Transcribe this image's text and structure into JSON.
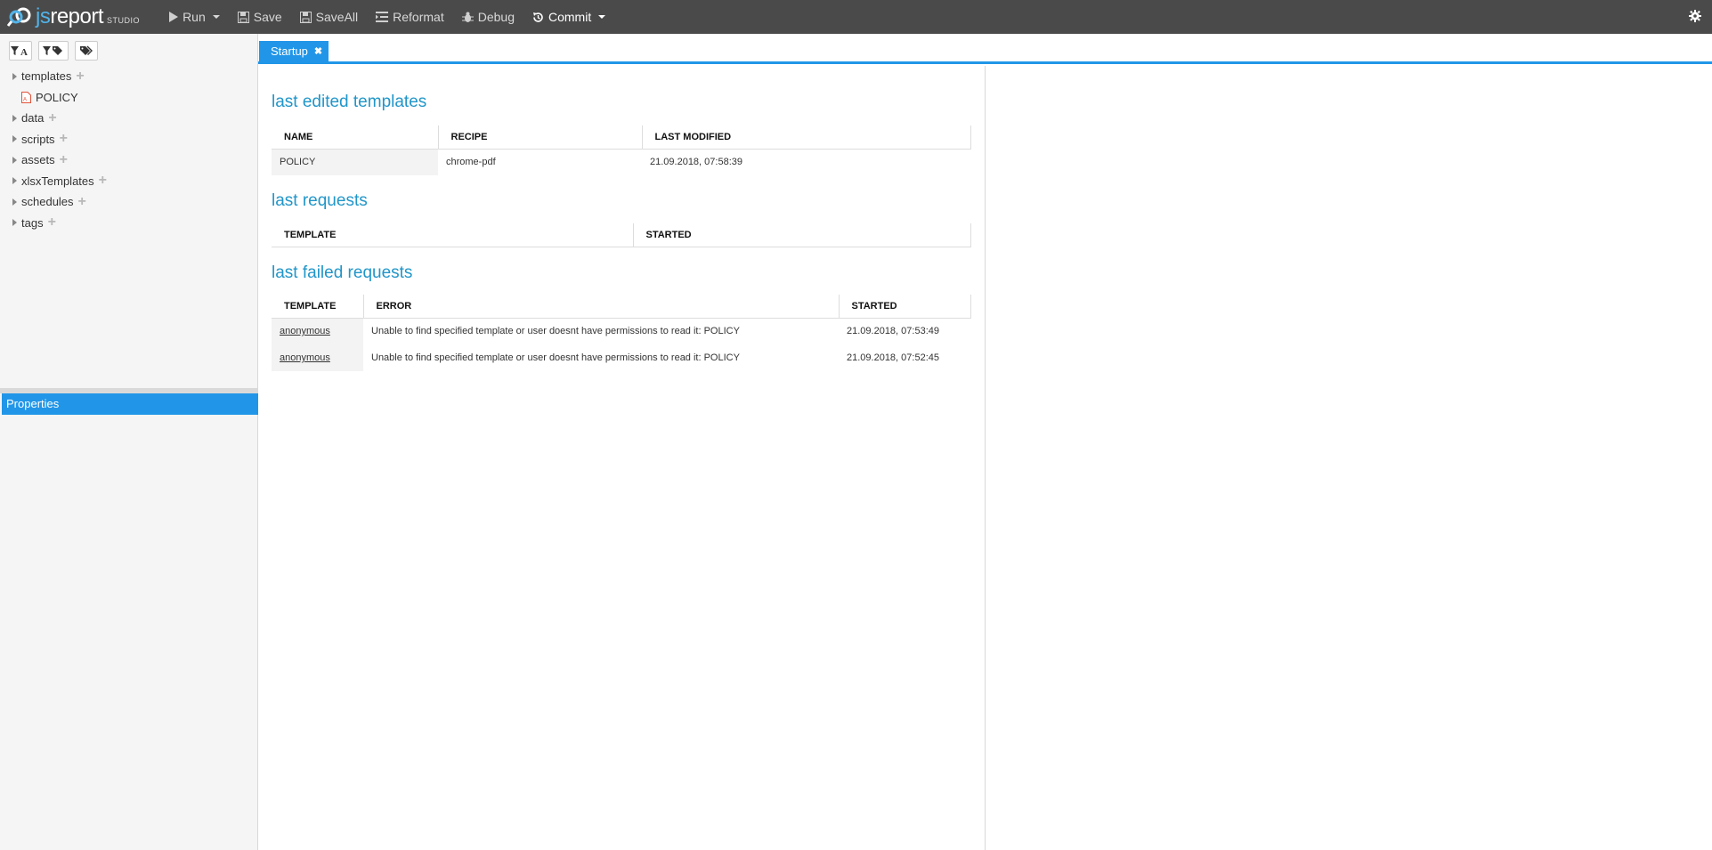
{
  "toolbar": {
    "logo_js": "js",
    "logo_report": "report",
    "logo_studio": "STUDIO",
    "run": "Run",
    "save": "Save",
    "save_all": "SaveAll",
    "reformat": "Reformat",
    "debug": "Debug",
    "commit": "Commit"
  },
  "sidebar": {
    "filter_buttons": [
      "filter-by-name",
      "filter-by-tag",
      "tags"
    ],
    "tree": [
      {
        "label": "templates",
        "expanded": true,
        "children": [
          {
            "label": "POLICY",
            "icon": "pdf-file-icon"
          }
        ]
      },
      {
        "label": "data"
      },
      {
        "label": "scripts"
      },
      {
        "label": "assets"
      },
      {
        "label": "xlsxTemplates"
      },
      {
        "label": "schedules"
      },
      {
        "label": "tags"
      }
    ],
    "properties_label": "Properties"
  },
  "tabs": [
    {
      "label": "Startup",
      "active": true
    }
  ],
  "startup": {
    "last_edited": {
      "title": "last edited templates",
      "columns": [
        "NAME",
        "RECIPE",
        "LAST MODIFIED"
      ],
      "rows": [
        [
          "POLICY",
          "chrome-pdf",
          "21.09.2018, 07:58:39"
        ]
      ]
    },
    "last_requests": {
      "title": "last requests",
      "columns": [
        "TEMPLATE",
        "STARTED"
      ],
      "rows": []
    },
    "last_failed": {
      "title": "last failed requests",
      "columns": [
        "TEMPLATE",
        "ERROR",
        "STARTED"
      ],
      "rows": [
        [
          "anonymous",
          "Unable to find specified template or user doesnt have permissions to read it: POLICY",
          "21.09.2018, 07:53:49"
        ],
        [
          "anonymous",
          "Unable to find specified template or user doesnt have permissions to read it: POLICY",
          "21.09.2018, 07:52:45"
        ]
      ]
    }
  },
  "colors": {
    "accent": "#2196e8",
    "toolbar_bg": "#4a4a4a",
    "heading": "#2196c9"
  }
}
